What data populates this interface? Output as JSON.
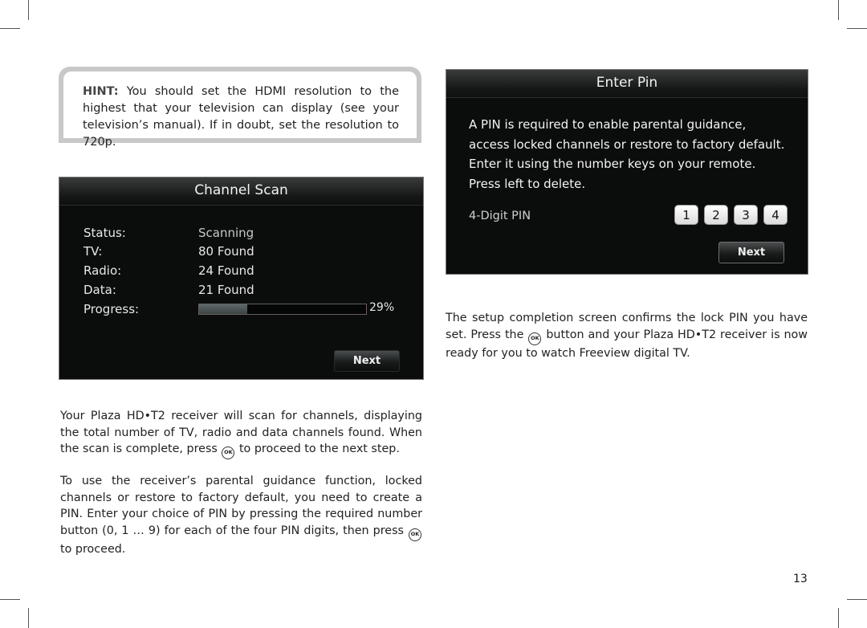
{
  "hint": {
    "label": "HINT:",
    "text": " You should set the HDMI resolution to the highest that your television can display (see your television’s manual). If in doubt, set the resolution to 720p."
  },
  "channel_scan": {
    "title": "Channel Scan",
    "rows": [
      {
        "label": "Status:",
        "value": "Scanning"
      },
      {
        "label": "TV:",
        "value": "80 Found"
      },
      {
        "label": "Radio:",
        "value": "24 Found"
      },
      {
        "label": "Data:",
        "value": "21 Found"
      }
    ],
    "progress_label": "Progress:",
    "progress_percent": 29,
    "progress_text": "29%",
    "next_label": "Next"
  },
  "enter_pin": {
    "title": "Enter Pin",
    "description": "A PIN is required to enable parental guidance, access locked channels or restore to factory default. Enter it using the number keys on your remote. Press left to delete.",
    "pin_label": "4-Digit PIN",
    "digits": [
      "1",
      "2",
      "3",
      "4"
    ],
    "next_label": "Next"
  },
  "paragraphs": {
    "scan_p1": "Your Plaza HD•T2 receiver will scan for channels, displaying the total number of TV, radio and data channels found. When the scan is complete, press",
    "scan_p2": "to proceed to the next step.",
    "pin_p1": "To use the receiver’s parental guidance function, locked channels or restore to factory default, you need to create a PIN. Enter your choice of PIN by pressing the required number button (0, 1 … 9) for each of the four PIN digits, then press",
    "pin_p2": "to proceed.",
    "done_p1": "The setup completion screen confirms the lock PIN you have set. Press the",
    "done_p2": "button and your Plaza HD•T2 receiver is now ready for you to watch Freeview digital TV."
  },
  "ok_icon_label": "OK",
  "page_number": "13"
}
